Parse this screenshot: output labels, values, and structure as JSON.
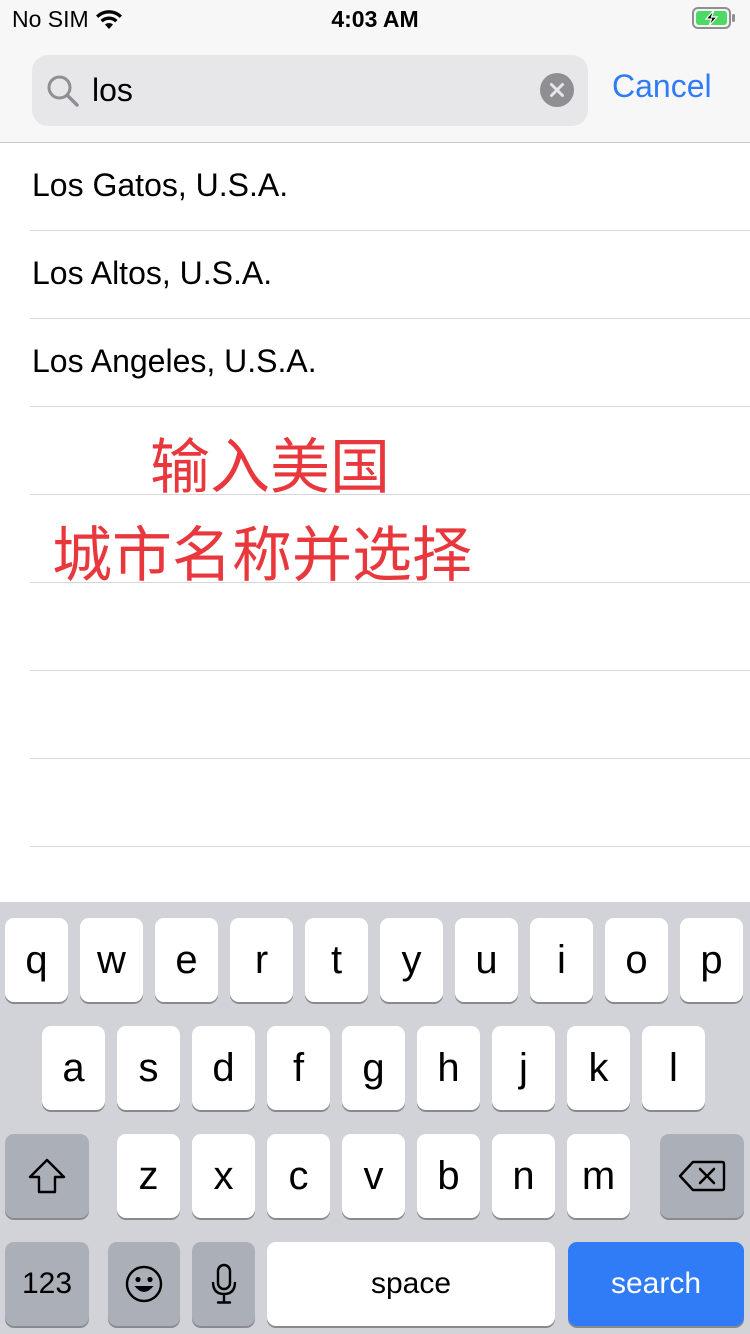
{
  "status_bar": {
    "carrier": "No SIM",
    "time": "4:03 AM"
  },
  "search": {
    "value": "los",
    "cancel_label": "Cancel"
  },
  "results": [
    "Los Gatos, U.S.A.",
    "Los Altos, U.S.A.",
    "Los Angeles, U.S.A."
  ],
  "empty_rows": 5,
  "annotation": {
    "line1": "输入美国",
    "line2": "城市名称并选择",
    "color": "#e8383d"
  },
  "keyboard": {
    "row1": [
      "q",
      "w",
      "e",
      "r",
      "t",
      "y",
      "u",
      "i",
      "o",
      "p"
    ],
    "row2": [
      "a",
      "s",
      "d",
      "f",
      "g",
      "h",
      "j",
      "k",
      "l"
    ],
    "row3": [
      "z",
      "x",
      "c",
      "v",
      "b",
      "n",
      "m"
    ],
    "numbers_label": "123",
    "space_label": "space",
    "search_label": "search",
    "accent_color": "#2f7cf6"
  }
}
